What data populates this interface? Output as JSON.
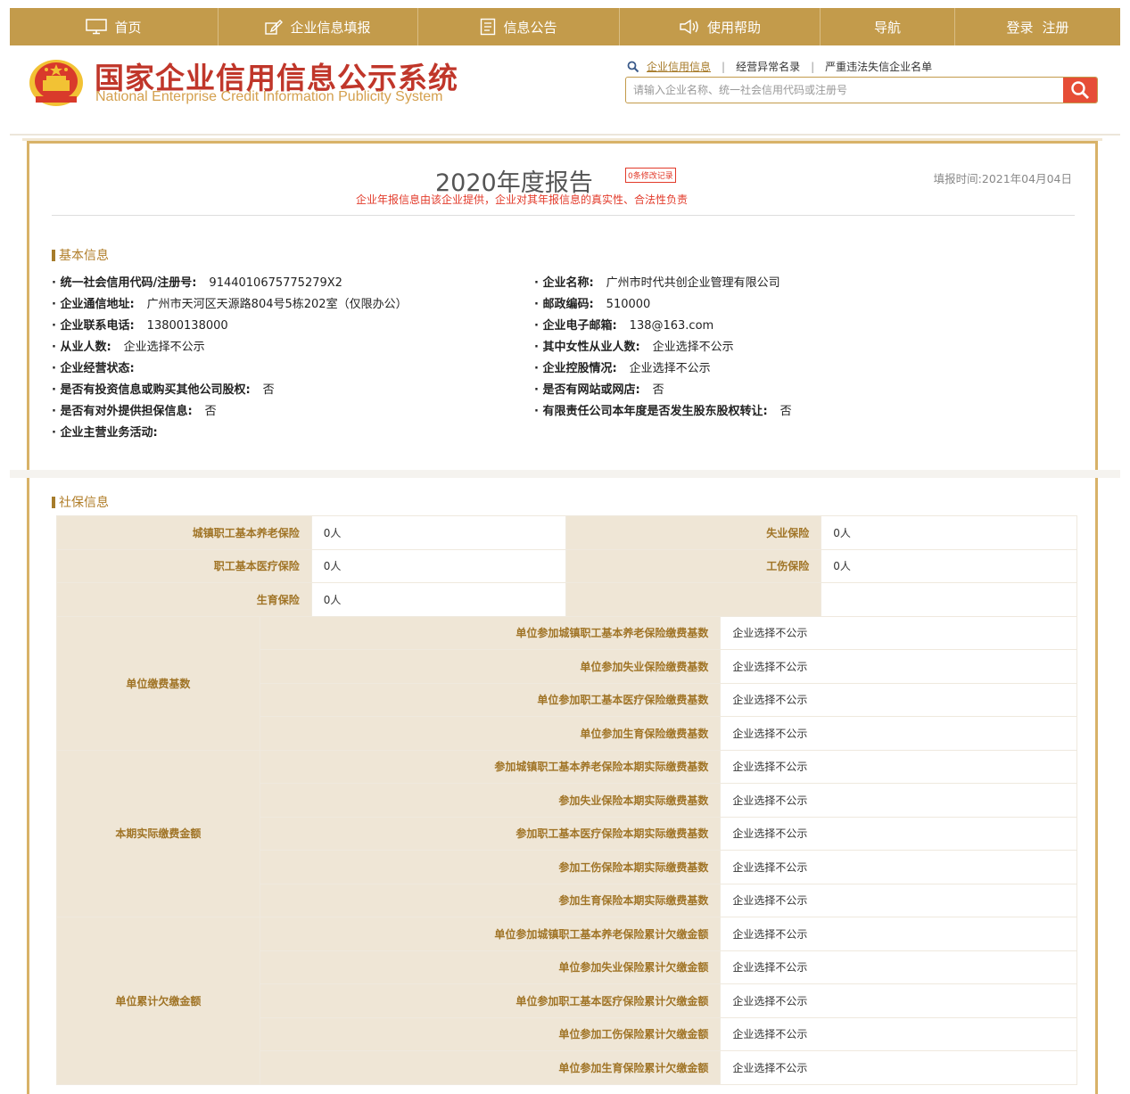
{
  "nav": {
    "items": [
      {
        "label": "首页",
        "icon": "monitor-icon"
      },
      {
        "label": "企业信息填报",
        "icon": "edit-icon"
      },
      {
        "label": "信息公告",
        "icon": "document-icon"
      },
      {
        "label": "使用帮助",
        "icon": "speaker-icon"
      },
      {
        "label": "导航",
        "icon": ""
      }
    ],
    "login": "登录",
    "register": "注册",
    "bg_color": "#c39b4b"
  },
  "header": {
    "title": "国家企业信用信息公示系统",
    "subtitle": "National Enterprise Credit Information Publicity System",
    "search_links": [
      "企业信用信息",
      "经营异常名录",
      "严重违法失信企业名单"
    ],
    "search_placeholder": "请输入企业名称、统一社会信用代码或注册号"
  },
  "report": {
    "title": "2020年度报告",
    "modify_badge": "0条修改记录",
    "note": "企业年报信息由该企业提供，企业对其年报信息的真实性、合法性负责",
    "fill_time": "填报时间:2021年04月04日"
  },
  "basic_info": {
    "section_title": "基本信息",
    "left": [
      {
        "label": "· 统一社会信用代码/注册号:",
        "value": "9144010675775279X2"
      },
      {
        "label": "· 企业通信地址:",
        "value": "广州市天河区天源路804号5栋202室（仅限办公）"
      },
      {
        "label": "· 企业联系电话:",
        "value": "13800138000"
      },
      {
        "label": "· 从业人数:",
        "value": "企业选择不公示"
      },
      {
        "label": "· 企业经营状态:",
        "value": ""
      },
      {
        "label": "· 是否有投资信息或购买其他公司股权:",
        "value": "否"
      },
      {
        "label": "· 是否有对外提供担保信息:",
        "value": "否"
      },
      {
        "label": "· 企业主营业务活动:",
        "value": ""
      }
    ],
    "right": [
      {
        "label": "· 企业名称:",
        "value": "广州市时代共创企业管理有限公司"
      },
      {
        "label": "· 邮政编码:",
        "value": "510000"
      },
      {
        "label": "· 企业电子邮箱:",
        "value": "138@163.com"
      },
      {
        "label": "· 其中女性从业人数:",
        "value": "企业选择不公示"
      },
      {
        "label": "· 企业控股情况:",
        "value": "企业选择不公示"
      },
      {
        "label": "· 是否有网站或网店:",
        "value": "否"
      },
      {
        "label": "· 有限责任公司本年度是否发生股东股权转让:",
        "value": "否"
      }
    ]
  },
  "social_insurance": {
    "section_title": "社保信息",
    "top_rows": [
      [
        {
          "label": "城镇职工基本养老保险",
          "value": "0人"
        },
        {
          "label": "失业保险",
          "value": "0人"
        }
      ],
      [
        {
          "label": "职工基本医疗保险",
          "value": "0人"
        },
        {
          "label": "工伤保险",
          "value": "0人"
        }
      ],
      [
        {
          "label": "生育保险",
          "value": "0人"
        },
        {
          "label": "",
          "value": ""
        }
      ]
    ],
    "groups": [
      {
        "name": "单位缴费基数",
        "rows": [
          {
            "label": "单位参加城镇职工基本养老保险缴费基数",
            "value": "企业选择不公示"
          },
          {
            "label": "单位参加失业保险缴费基数",
            "value": "企业选择不公示"
          },
          {
            "label": "单位参加职工基本医疗保险缴费基数",
            "value": "企业选择不公示"
          },
          {
            "label": "单位参加生育保险缴费基数",
            "value": "企业选择不公示"
          }
        ]
      },
      {
        "name": "本期实际缴费金额",
        "rows": [
          {
            "label": "参加城镇职工基本养老保险本期实际缴费基数",
            "value": "企业选择不公示"
          },
          {
            "label": "参加失业保险本期实际缴费基数",
            "value": "企业选择不公示"
          },
          {
            "label": "参加职工基本医疗保险本期实际缴费基数",
            "value": "企业选择不公示"
          },
          {
            "label": "参加工伤保险本期实际缴费基数",
            "value": "企业选择不公示"
          },
          {
            "label": "参加生育保险本期实际缴费基数",
            "value": "企业选择不公示"
          }
        ]
      },
      {
        "name": "单位累计欠缴金额",
        "rows": [
          {
            "label": "单位参加城镇职工基本养老保险累计欠缴金额",
            "value": "企业选择不公示"
          },
          {
            "label": "单位参加失业保险累计欠缴金额",
            "value": "企业选择不公示"
          },
          {
            "label": "单位参加职工基本医疗保险累计欠缴金额",
            "value": "企业选择不公示"
          },
          {
            "label": "单位参加工伤保险累计欠缴金额",
            "value": "企业选择不公示"
          },
          {
            "label": "单位参加生育保险累计欠缴金额",
            "value": "企业选择不公示"
          }
        ]
      }
    ]
  }
}
